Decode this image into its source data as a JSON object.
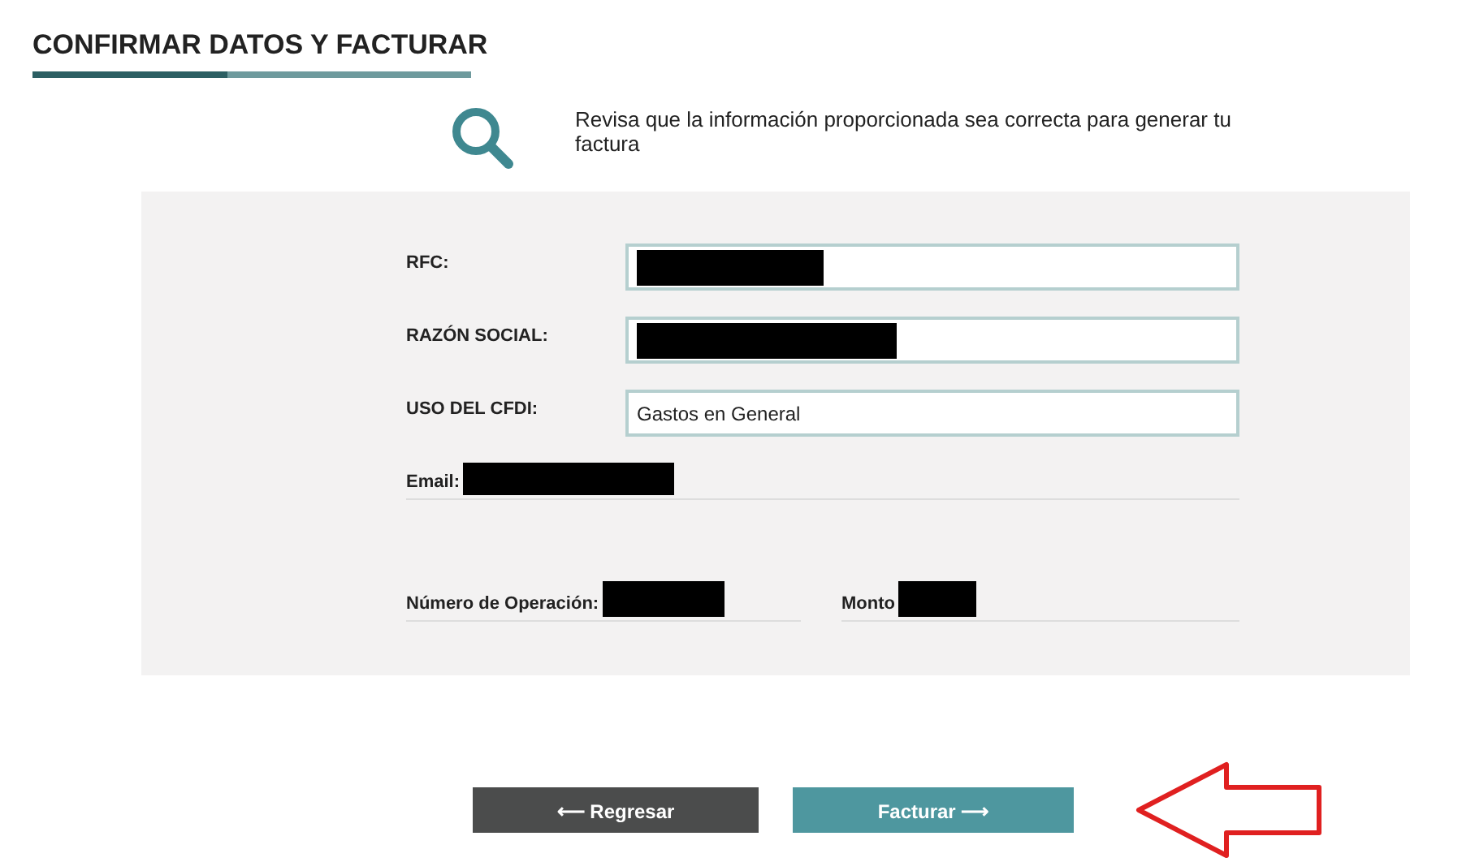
{
  "header": {
    "title": "CONFIRMAR DATOS Y FACTURAR"
  },
  "notice": {
    "text": "Revisa que la información proporcionada sea correcta para generar tu factura"
  },
  "form_fields": [
    {
      "label": "RFC:",
      "redacted": true
    },
    {
      "label": "RAZÓN SOCIAL:",
      "redacted": true
    },
    {
      "label": "USO DEL CFDI:",
      "value": "Gastos en General",
      "redacted": false
    }
  ],
  "summary_fields": [
    {
      "label": "Email:",
      "redacted": true
    }
  ],
  "operation_fields": [
    {
      "label": "Número de Operación:",
      "redacted": true
    },
    {
      "label": "Monto",
      "redacted": true
    }
  ],
  "buttons": [
    {
      "kind": "back",
      "label": "⟵ Regresar"
    },
    {
      "kind": "primary",
      "label": "Facturar ⟶"
    }
  ]
}
